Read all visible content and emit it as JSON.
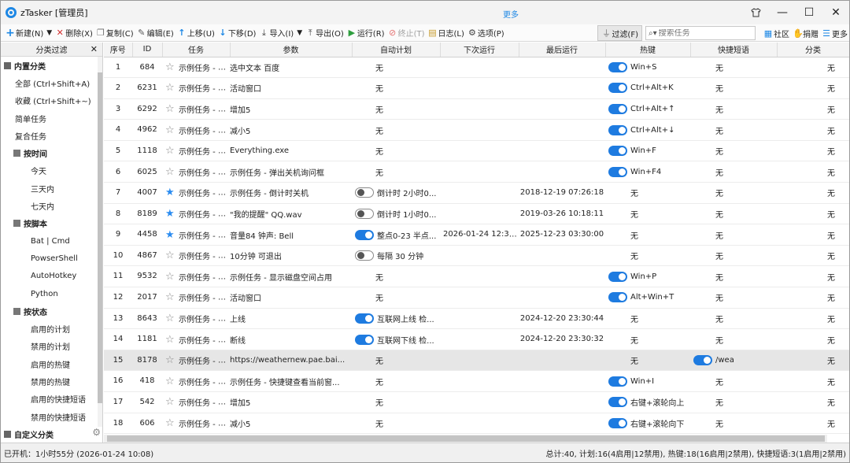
{
  "window": {
    "title": "zTasker [管理员]",
    "more_link": "更多"
  },
  "toolbar": {
    "new": "新建(N)",
    "delete": "删除(X)",
    "copy": "复制(C)",
    "edit": "编辑(E)",
    "move_up": "上移(U)",
    "move_down": "下移(D)",
    "import": "导入(I)",
    "export": "导出(O)",
    "run": "运行(R)",
    "stop": "终止(T)",
    "log": "日志(L)",
    "options": "选项(P)",
    "filter": "过滤(F)",
    "search_placeholder": "搜索任务",
    "community": "社区",
    "donate": "捐赠",
    "more": "更多"
  },
  "sidebar": {
    "header": "分类过滤",
    "builtin": "内置分类",
    "all": "全部 (Ctrl+Shift+A)",
    "favorites": "收藏 (Ctrl+Shift+~)",
    "simple": "简单任务",
    "compound": "复合任务",
    "by_time": "按时间",
    "today": "今天",
    "three_days": "三天内",
    "seven_days": "七天内",
    "by_script": "按脚本",
    "bat": "Bat | Cmd",
    "powershell": "PowserShell",
    "autohotkey": "AutoHotkey",
    "python": "Python",
    "by_status": "按状态",
    "enabled_plans": "启用的计划",
    "disabled_plans": "禁用的计划",
    "enabled_hotkeys": "启用的热键",
    "disabled_hotkeys": "禁用的热键",
    "enabled_phrases": "启用的快捷短语",
    "disabled_phrases": "禁用的快捷短语",
    "custom": "自定义分类"
  },
  "columns": [
    "序号",
    "ID",
    "任务",
    "参数",
    "自动计划",
    "下次运行",
    "最后运行",
    "热键",
    "快捷短语",
    "分类"
  ],
  "rows": [
    {
      "no": "1",
      "id": "684",
      "fav": false,
      "task": "示例任务 - 网络...",
      "param": "选中文本 百度",
      "plan_toggle": null,
      "plan": "无",
      "next": "",
      "last": "",
      "hk_toggle": "on",
      "hotkey": "Win+S",
      "ph_toggle": null,
      "phrase": "无",
      "cat": "无"
    },
    {
      "no": "2",
      "id": "6231",
      "fav": false,
      "task": "示例任务 - 关闭...",
      "param": "活动窗口",
      "plan_toggle": null,
      "plan": "无",
      "next": "",
      "last": "",
      "hk_toggle": "on",
      "hotkey": "Ctrl+Alt+K",
      "ph_toggle": null,
      "phrase": "无",
      "cat": "无"
    },
    {
      "no": "3",
      "id": "6292",
      "fav": false,
      "task": "示例任务 - 增加...",
      "param": "增加5",
      "plan_toggle": null,
      "plan": "无",
      "next": "",
      "last": "",
      "hk_toggle": "on",
      "hotkey": "Ctrl+Alt+↑",
      "ph_toggle": null,
      "phrase": "无",
      "cat": "无"
    },
    {
      "no": "4",
      "id": "4962",
      "fav": false,
      "task": "示例任务 - 减小...",
      "param": "减小5",
      "plan_toggle": null,
      "plan": "无",
      "next": "",
      "last": "",
      "hk_toggle": "on",
      "hotkey": "Ctrl+Alt+↓",
      "ph_toggle": null,
      "phrase": "无",
      "cat": "无"
    },
    {
      "no": "5",
      "id": "1118",
      "fav": false,
      "task": "示例任务 - 运行...",
      "param": "Everything.exe",
      "plan_toggle": null,
      "plan": "无",
      "next": "",
      "last": "",
      "hk_toggle": "on",
      "hotkey": "Win+F",
      "ph_toggle": null,
      "phrase": "无",
      "cat": "无"
    },
    {
      "no": "6",
      "id": "6025",
      "fav": false,
      "task": "示例任务 - 弹出...",
      "param": "示例任务 - 弹出关机询问框",
      "plan_toggle": null,
      "plan": "无",
      "next": "",
      "last": "",
      "hk_toggle": "on",
      "hotkey": "Win+F4",
      "ph_toggle": null,
      "phrase": "无",
      "cat": "无"
    },
    {
      "no": "7",
      "id": "4007",
      "fav": true,
      "task": "示例任务 - 倒计...",
      "param": "示例任务 - 倒计时关机",
      "plan_toggle": "off",
      "plan": "倒计时 2小时0...",
      "next": "",
      "last": "2018-12-19 07:26:18",
      "hk_toggle": null,
      "hotkey": "无",
      "ph_toggle": null,
      "phrase": "无",
      "cat": "无"
    },
    {
      "no": "8",
      "id": "8189",
      "fav": true,
      "task": "示例任务 - 弹窗...",
      "param": "\"我的提醒\" QQ.wav",
      "plan_toggle": "off",
      "plan": "倒计时 1小时0...",
      "next": "",
      "last": "2019-03-26 10:18:11",
      "hk_toggle": null,
      "hotkey": "无",
      "ph_toggle": null,
      "phrase": "无",
      "cat": "无"
    },
    {
      "no": "9",
      "id": "4458",
      "fav": true,
      "task": "示例任务 - 整点...",
      "param": "音量84 钟声: Bell",
      "plan_toggle": "on",
      "plan": "整点0-23 半点...",
      "next": "2026-01-24 12:30:00...",
      "last": "2025-12-23 03:30:00",
      "hk_toggle": null,
      "hotkey": "无",
      "ph_toggle": null,
      "phrase": "无",
      "cat": "无"
    },
    {
      "no": "10",
      "id": "4867",
      "fav": false,
      "task": "示例任务 - 挡屏...",
      "param": "10分钟 可退出",
      "plan_toggle": "off",
      "plan": "每隔 30 分钟",
      "next": "",
      "last": "",
      "hk_toggle": null,
      "hotkey": "无",
      "ph_toggle": null,
      "phrase": "无",
      "cat": "无"
    },
    {
      "no": "11",
      "id": "9532",
      "fav": false,
      "task": "示例任务 - 显示...",
      "param": "示例任务 - 显示磁盘空间占用",
      "plan_toggle": null,
      "plan": "无",
      "next": "",
      "last": "",
      "hk_toggle": "on",
      "hotkey": "Win+P",
      "ph_toggle": null,
      "phrase": "无",
      "cat": "无"
    },
    {
      "no": "12",
      "id": "2017",
      "fav": false,
      "task": "示例任务 - 老板...",
      "param": "活动窗口",
      "plan_toggle": null,
      "plan": "无",
      "next": "",
      "last": "",
      "hk_toggle": "on",
      "hotkey": "Alt+Win+T",
      "ph_toggle": null,
      "phrase": "无",
      "cat": "无"
    },
    {
      "no": "13",
      "id": "8643",
      "fav": false,
      "task": "示例任务 - 网络...",
      "param": "上线",
      "plan_toggle": "on",
      "plan": "互联网上线 检...",
      "next": "",
      "last": "2024-12-20 23:30:44",
      "hk_toggle": null,
      "hotkey": "无",
      "ph_toggle": null,
      "phrase": "无",
      "cat": "无"
    },
    {
      "no": "14",
      "id": "1181",
      "fav": false,
      "task": "示例任务 - 网络...",
      "param": "断线",
      "plan_toggle": "on",
      "plan": "互联网下线 检...",
      "next": "",
      "last": "2024-12-20 23:30:32",
      "hk_toggle": null,
      "hotkey": "无",
      "ph_toggle": null,
      "phrase": "无",
      "cat": "无"
    },
    {
      "no": "15",
      "id": "8178",
      "fav": false,
      "task": "示例任务 - 查看...",
      "param": "https://weathernew.pae.bai...",
      "plan_toggle": null,
      "plan": "无",
      "next": "",
      "last": "",
      "hk_toggle": null,
      "hotkey": "无",
      "ph_toggle": "on",
      "phrase": "/wea",
      "cat": "无",
      "selected": true
    },
    {
      "no": "16",
      "id": "418",
      "fav": false,
      "task": "示例任务 - 快捷...",
      "param": "示例任务 - 快捷键查看当前窗...",
      "plan_toggle": null,
      "plan": "无",
      "next": "",
      "last": "",
      "hk_toggle": "on",
      "hotkey": "Win+I",
      "ph_toggle": null,
      "phrase": "无",
      "cat": "无"
    },
    {
      "no": "17",
      "id": "542",
      "fav": false,
      "task": "示例任务 - 右键...",
      "param": "增加5",
      "plan_toggle": null,
      "plan": "无",
      "next": "",
      "last": "",
      "hk_toggle": "on",
      "hotkey": "右键+滚轮向上",
      "ph_toggle": null,
      "phrase": "无",
      "cat": "无"
    },
    {
      "no": "18",
      "id": "606",
      "fav": false,
      "task": "示例任务 - 右键...",
      "param": "减小5",
      "plan_toggle": null,
      "plan": "无",
      "next": "",
      "last": "",
      "hk_toggle": "on",
      "hotkey": "右键+滚轮向下",
      "ph_toggle": null,
      "phrase": "无",
      "cat": "无"
    }
  ],
  "status": {
    "left": "已开机：1小时55分 (2026-01-24 10:08)",
    "right": "总计:40, 计划:16(4启用|12禁用), 热键:18(16启用|2禁用), 快捷短语:3(1启用|2禁用)"
  },
  "colors": {
    "accent": "#1e7be0",
    "fav_star": "#2b8cf0",
    "new_icon": "#1e88e5",
    "delete_icon": "#d32f2f",
    "run_icon": "#2e9e3e"
  }
}
